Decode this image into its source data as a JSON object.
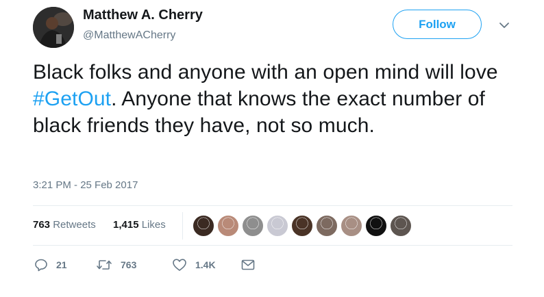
{
  "author": {
    "name": "Matthew A. Cherry",
    "handle": "@MatthewACherry"
  },
  "follow_label": "Follow",
  "tweet": {
    "text_before": "Black folks and anyone with an open mind will love ",
    "hashtag": "#GetOut",
    "text_after": ". Anyone that knows the exact number of black friends they have, not so much.",
    "timestamp": "3:21 PM - 25 Feb 2017"
  },
  "stats": {
    "retweets_count": "763",
    "retweets_label": "Retweets",
    "likes_count": "1,415",
    "likes_label": "Likes"
  },
  "liker_avatars": [
    {
      "name": "liker-avatar-1",
      "color": "#3b2a22"
    },
    {
      "name": "liker-avatar-2",
      "color": "#b98a78"
    },
    {
      "name": "liker-avatar-3",
      "color": "#8e8e8e"
    },
    {
      "name": "liker-avatar-4",
      "color": "#c9c9d3"
    },
    {
      "name": "liker-avatar-5",
      "color": "#4a3326"
    },
    {
      "name": "liker-avatar-6",
      "color": "#7d6a60"
    },
    {
      "name": "liker-avatar-7",
      "color": "#a88f84"
    },
    {
      "name": "liker-avatar-8",
      "color": "#111111"
    },
    {
      "name": "liker-avatar-9",
      "color": "#5d5550"
    }
  ],
  "actions": {
    "reply_count": "21",
    "retweet_count": "763",
    "like_count": "1.4K"
  },
  "colors": {
    "accent": "#1da1f2",
    "text": "#14171a",
    "secondary": "#657786",
    "divider": "#e6ecf0"
  }
}
